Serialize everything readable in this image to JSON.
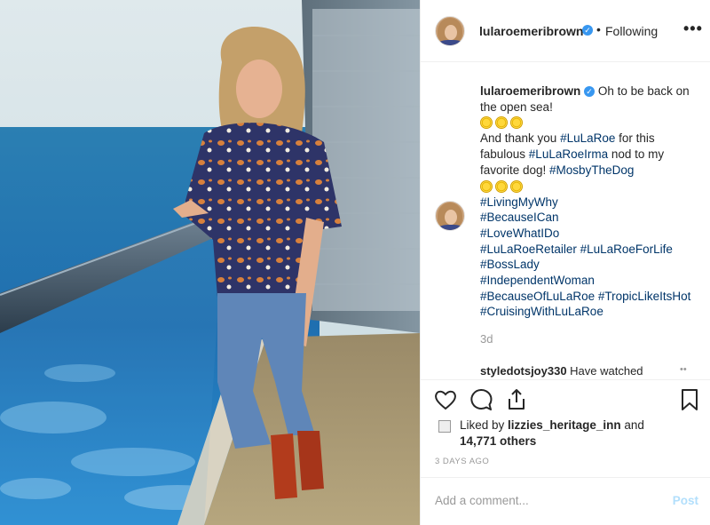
{
  "photo": {
    "alt": "Woman on cruise ship balcony by the sea"
  },
  "header": {
    "username": "lularoemeribrown",
    "verified_icon": "verified-badge-icon",
    "separator": "•",
    "follow_state": "Following",
    "more_label": "•••"
  },
  "caption": {
    "username": "lularoemeribrown",
    "line1": "Oh to be back on the open sea!",
    "line2_prefix": "And thank you ",
    "tag_lularoe": "#LuLaRoe",
    "line2_mid": " for this fabulous ",
    "tag_irma": "#LuLaRoeIrma",
    "line2_suffix": " nod to my favorite dog! ",
    "tag_mosby": "#MosbyTheDog",
    "hashtags": [
      "#LivingMyWhy",
      "#BecauseICan",
      "#LoveWhatIDo",
      "#LuLaRoeRetailer #LuLaRoeForLife",
      "#BossLady",
      "#IndependentWoman",
      "#BecauseOfLuLaRoe #TropicLikeItsHot",
      "#CruisingWithLuLaRoe"
    ],
    "time": "3d"
  },
  "next_comment": {
    "username": "styledotsjoy330",
    "text": " Have watched"
  },
  "actions": {
    "like_icon": "heart-icon",
    "comment_icon": "comment-bubble-icon",
    "share_icon": "share-icon",
    "save_icon": "bookmark-icon"
  },
  "likes": {
    "prefix": "Liked by ",
    "user": "lizzies_heritage_inn",
    "mid": " and",
    "count": "14,771 others"
  },
  "timestamp": "3 DAYS AGO",
  "comment_box": {
    "placeholder": "Add a comment...",
    "post_label": "Post"
  },
  "colors": {
    "link": "#003569",
    "verified": "#3897f0",
    "post_disabled": "#b2dffc",
    "muted": "#999999"
  }
}
